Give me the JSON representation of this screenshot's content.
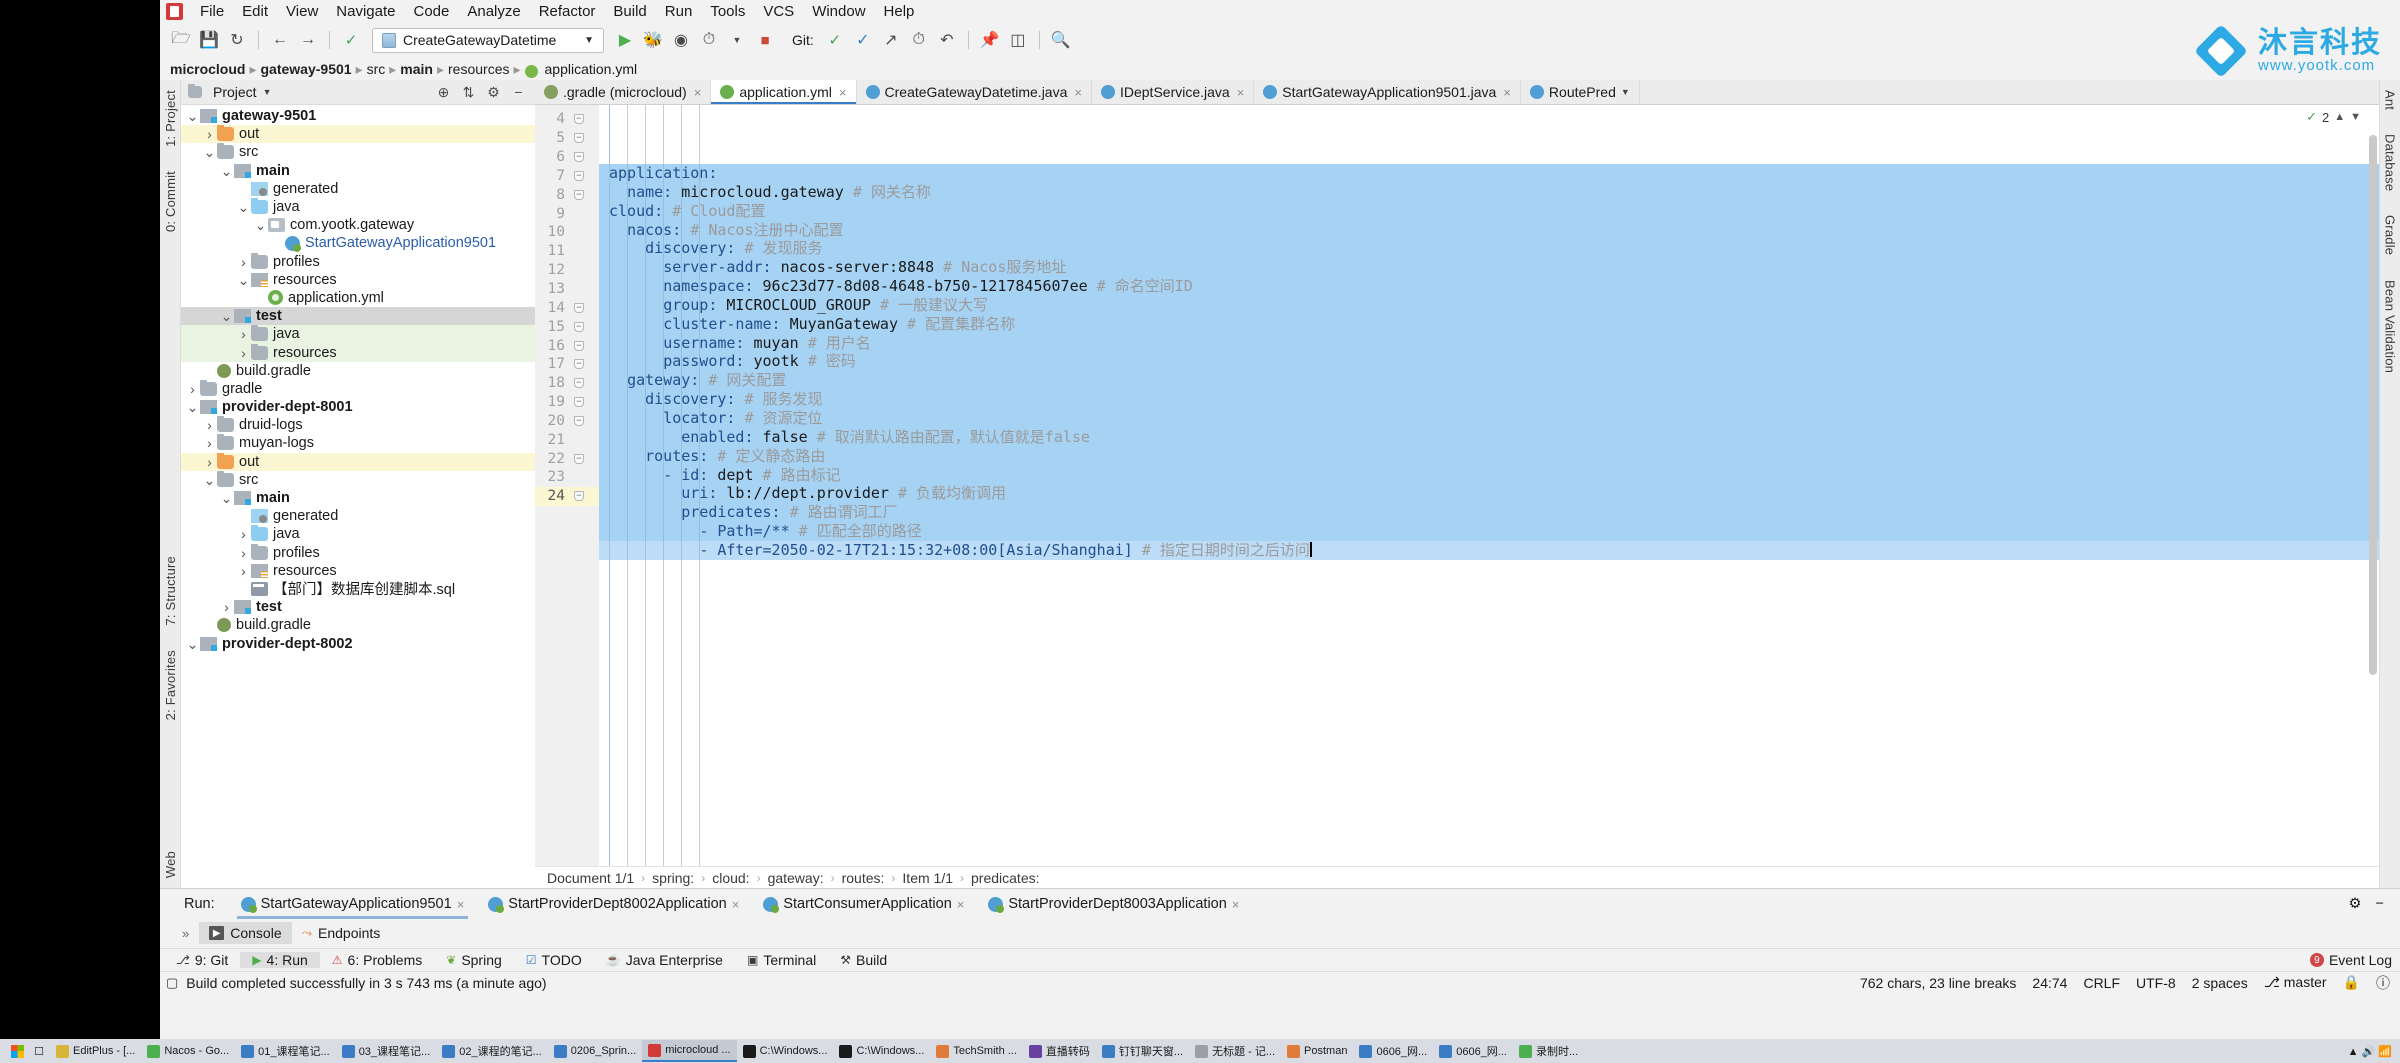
{
  "menubar": {
    "items": [
      "File",
      "Edit",
      "View",
      "Navigate",
      "Code",
      "Analyze",
      "Refactor",
      "Build",
      "Run",
      "Tools",
      "VCS",
      "Window",
      "Help"
    ]
  },
  "toolbar": {
    "run_config": "CreateGatewayDatetime",
    "git_label": "Git:",
    "watermark_cn": "沐言科技",
    "watermark_url": "www.yootk.com"
  },
  "breadcrumb": {
    "items": [
      "microcloud",
      "gateway-9501",
      "src",
      "main",
      "resources",
      "application.yml"
    ]
  },
  "project_panel": {
    "title": "Project",
    "tree": [
      {
        "label": "gateway-9501",
        "depth": 0,
        "twist": "v",
        "icon": "folder-src",
        "bold": true,
        "hl": ""
      },
      {
        "label": "out",
        "depth": 1,
        "twist": ">",
        "icon": "folder-orange",
        "bold": false,
        "hl": "hl-yellow"
      },
      {
        "label": "src",
        "depth": 1,
        "twist": "v",
        "icon": "folder",
        "bold": false,
        "hl": ""
      },
      {
        "label": "main",
        "depth": 2,
        "twist": "v",
        "icon": "folder-src",
        "bold": true,
        "hl": ""
      },
      {
        "label": "generated",
        "depth": 3,
        "twist": "",
        "icon": "folder-gen",
        "bold": false,
        "hl": ""
      },
      {
        "label": "java",
        "depth": 3,
        "twist": "v",
        "icon": "folder-blue",
        "bold": false,
        "hl": ""
      },
      {
        "label": "com.yootk.gateway",
        "depth": 4,
        "twist": "v",
        "icon": "pkg",
        "bold": false,
        "hl": ""
      },
      {
        "label": "StartGatewayApplication9501",
        "depth": 5,
        "twist": "",
        "icon": "javacls",
        "bold": false,
        "hl": "",
        "blue": true
      },
      {
        "label": "profiles",
        "depth": 3,
        "twist": ">",
        "icon": "folder",
        "bold": false,
        "hl": ""
      },
      {
        "label": "resources",
        "depth": 3,
        "twist": "v",
        "icon": "folder-res",
        "bold": false,
        "hl": ""
      },
      {
        "label": "application.yml",
        "depth": 4,
        "twist": "",
        "icon": "yml",
        "bold": false,
        "hl": ""
      },
      {
        "label": "test",
        "depth": 2,
        "twist": "v",
        "icon": "folder-src",
        "bold": true,
        "hl": "hl-gray"
      },
      {
        "label": "java",
        "depth": 3,
        "twist": ">",
        "icon": "folder",
        "bold": false,
        "hl": "hl-green"
      },
      {
        "label": "resources",
        "depth": 3,
        "twist": ">",
        "icon": "folder",
        "bold": false,
        "hl": "hl-green"
      },
      {
        "label": "build.gradle",
        "depth": 1,
        "twist": "",
        "icon": "gradlefile",
        "bold": false,
        "hl": ""
      },
      {
        "label": "gradle",
        "depth": 0,
        "twist": ">",
        "icon": "folder",
        "bold": false,
        "hl": ""
      },
      {
        "label": "provider-dept-8001",
        "depth": 0,
        "twist": "v",
        "icon": "folder-src",
        "bold": true,
        "hl": ""
      },
      {
        "label": "druid-logs",
        "depth": 1,
        "twist": ">",
        "icon": "folder",
        "bold": false,
        "hl": ""
      },
      {
        "label": "muyan-logs",
        "depth": 1,
        "twist": ">",
        "icon": "folder",
        "bold": false,
        "hl": ""
      },
      {
        "label": "out",
        "depth": 1,
        "twist": ">",
        "icon": "folder-orange",
        "bold": false,
        "hl": "hl-yellow"
      },
      {
        "label": "src",
        "depth": 1,
        "twist": "v",
        "icon": "folder",
        "bold": false,
        "hl": ""
      },
      {
        "label": "main",
        "depth": 2,
        "twist": "v",
        "icon": "folder-src",
        "bold": true,
        "hl": ""
      },
      {
        "label": "generated",
        "depth": 3,
        "twist": "",
        "icon": "folder-gen",
        "bold": false,
        "hl": ""
      },
      {
        "label": "java",
        "depth": 3,
        "twist": ">",
        "icon": "folder-blue",
        "bold": false,
        "hl": ""
      },
      {
        "label": "profiles",
        "depth": 3,
        "twist": ">",
        "icon": "folder",
        "bold": false,
        "hl": ""
      },
      {
        "label": "resources",
        "depth": 3,
        "twist": ">",
        "icon": "folder-res",
        "bold": false,
        "hl": ""
      },
      {
        "label": "【部门】数据库创建脚本.sql",
        "depth": 3,
        "twist": "",
        "icon": "sql",
        "bold": false,
        "hl": ""
      },
      {
        "label": "test",
        "depth": 2,
        "twist": ">",
        "icon": "folder-src",
        "bold": true,
        "hl": ""
      },
      {
        "label": "build.gradle",
        "depth": 1,
        "twist": "",
        "icon": "gradlefile",
        "bold": false,
        "hl": ""
      },
      {
        "label": "provider-dept-8002",
        "depth": 0,
        "twist": "v",
        "icon": "folder-src",
        "bold": true,
        "hl": ""
      }
    ]
  },
  "editor_tabs": [
    {
      "label": ".gradle (microcloud)",
      "icon": "gradle",
      "active": false,
      "close": true
    },
    {
      "label": "application.yml",
      "icon": "ymlg",
      "active": true,
      "close": true
    },
    {
      "label": "CreateGatewayDatetime.java",
      "icon": "javac",
      "active": false,
      "close": true
    },
    {
      "label": "IDeptService.java",
      "icon": "ifc",
      "active": false,
      "close": true
    },
    {
      "label": "StartGatewayApplication9501.java",
      "icon": "javac",
      "active": false,
      "close": true
    },
    {
      "label": "RoutePred",
      "icon": "javac",
      "active": false,
      "close": false
    }
  ],
  "inspection_widget": {
    "count": "2"
  },
  "code": {
    "first_line": 4,
    "lines": [
      {
        "n": 4,
        "indent": 0,
        "key": "application:",
        "value": "",
        "comment": "",
        "fold": true,
        "sel": true
      },
      {
        "n": 5,
        "indent": 2,
        "key": "name:",
        "value": "microcloud.gateway",
        "comment": "# 网关名称",
        "fold": true,
        "sel": true
      },
      {
        "n": 6,
        "indent": 0,
        "key": "cloud:",
        "value": "",
        "comment": "# Cloud配置",
        "fold": true,
        "sel": true
      },
      {
        "n": 7,
        "indent": 2,
        "key": "nacos:",
        "value": "",
        "comment": "# Nacos注册中心配置",
        "fold": true,
        "sel": true
      },
      {
        "n": 8,
        "indent": 4,
        "key": "discovery:",
        "value": "",
        "comment": "# 发现服务",
        "fold": true,
        "sel": true
      },
      {
        "n": 9,
        "indent": 6,
        "key": "server-addr:",
        "value": "nacos-server:8848",
        "comment": "# Nacos服务地址",
        "fold": false,
        "sel": true
      },
      {
        "n": 10,
        "indent": 6,
        "key": "namespace:",
        "value": "96c23d77-8d08-4648-b750-1217845607ee",
        "comment": "# 命名空间ID",
        "fold": false,
        "sel": true
      },
      {
        "n": 11,
        "indent": 6,
        "key": "group:",
        "value": "MICROCLOUD_GROUP",
        "comment": "# 一般建议大写",
        "fold": false,
        "sel": true
      },
      {
        "n": 12,
        "indent": 6,
        "key": "cluster-name:",
        "value": "MuyanGateway",
        "comment": "# 配置集群名称",
        "fold": false,
        "sel": true
      },
      {
        "n": 13,
        "indent": 6,
        "key": "username:",
        "value": "muyan",
        "comment": "# 用户名",
        "fold": false,
        "sel": true
      },
      {
        "n": 14,
        "indent": 6,
        "key": "password:",
        "value": "yootk",
        "comment": "# 密码",
        "fold": true,
        "sel": true
      },
      {
        "n": 15,
        "indent": 2,
        "key": "gateway:",
        "value": "",
        "comment": "# 网关配置",
        "fold": true,
        "sel": true
      },
      {
        "n": 16,
        "indent": 4,
        "key": "discovery:",
        "value": "",
        "comment": "# 服务发现",
        "fold": true,
        "sel": true
      },
      {
        "n": 17,
        "indent": 6,
        "key": "locator:",
        "value": "",
        "comment": "# 资源定位",
        "fold": true,
        "sel": true
      },
      {
        "n": 18,
        "indent": 8,
        "key": "enabled:",
        "value": "false",
        "comment": "# 取消默认路由配置，默认值就是false",
        "fold": true,
        "sel": true
      },
      {
        "n": 19,
        "indent": 4,
        "key": "routes:",
        "value": "",
        "comment": "# 定义静态路由",
        "fold": true,
        "sel": true
      },
      {
        "n": 20,
        "indent": 6,
        "key": "- id:",
        "value": "dept",
        "comment": "# 路由标记",
        "fold": true,
        "sel": true
      },
      {
        "n": 21,
        "indent": 8,
        "key": "uri:",
        "value": "lb://dept.provider",
        "comment": "# 负载均衡调用",
        "fold": false,
        "sel": true
      },
      {
        "n": 22,
        "indent": 8,
        "key": "predicates:",
        "value": "",
        "comment": "# 路由谓词工厂",
        "fold": true,
        "sel": true
      },
      {
        "n": 23,
        "indent": 10,
        "key": "- Path=/**",
        "value": "",
        "comment": "# 匹配全部的路径",
        "fold": false,
        "sel": true
      },
      {
        "n": 24,
        "indent": 10,
        "key": "- After=2050-02-17T21:15:32+08:00[Asia/Shanghai]",
        "value": "",
        "comment": "# 指定日期时间之后访问",
        "fold": true,
        "sel": true,
        "cursor": true
      }
    ]
  },
  "editor_footer_crumbs": [
    "Document 1/1",
    "spring:",
    "cloud:",
    "gateway:",
    "routes:",
    "Item 1/1",
    "predicates:"
  ],
  "run_window": {
    "label": "Run:",
    "tabs": [
      {
        "label": "StartGatewayApplication9501",
        "active": true
      },
      {
        "label": "StartProviderDept8002Application",
        "active": false
      },
      {
        "label": "StartConsumerApplication",
        "active": false
      },
      {
        "label": "StartProviderDept8003Application",
        "active": false
      }
    ],
    "subtabs": [
      {
        "label": "Console",
        "icon": "console",
        "active": true
      },
      {
        "label": "Endpoints",
        "icon": "endpoints",
        "active": false
      }
    ]
  },
  "bottom_toolstrip": {
    "items": [
      {
        "label": "9: Git",
        "icon": "git"
      },
      {
        "label": "4: Run",
        "icon": "run",
        "active": true
      },
      {
        "label": "6: Problems",
        "icon": "problems"
      },
      {
        "label": "Spring",
        "icon": "spring"
      },
      {
        "label": "TODO",
        "icon": "todo"
      },
      {
        "label": "Java Enterprise",
        "icon": "javaee"
      },
      {
        "label": "Terminal",
        "icon": "terminal"
      },
      {
        "label": "Build",
        "icon": "build"
      }
    ],
    "event_log": "Event Log",
    "event_log_count": "9"
  },
  "statusbar": {
    "message": "Build completed successfully in 3 s 743 ms (a minute ago)",
    "right": [
      "762 chars, 23 line breaks",
      "24:74",
      "CRLF",
      "UTF-8",
      "2 spaces",
      "master"
    ]
  },
  "left_strips": [
    {
      "label": "1: Project"
    },
    {
      "label": "0: Commit"
    },
    {
      "label": "7: Structure"
    },
    {
      "label": "2: Favorites"
    },
    {
      "label": "Web"
    }
  ],
  "right_strips": [
    {
      "label": "Ant"
    },
    {
      "label": "Database"
    },
    {
      "label": "Gradle"
    },
    {
      "label": "Bean Validation"
    }
  ],
  "taskbar": {
    "apps": [
      {
        "label": "EditPlus - [...",
        "color": "#d8b43a"
      },
      {
        "label": "Nacos - Go...",
        "color": "#4caf50"
      },
      {
        "label": "01_课程笔记...",
        "color": "#3b7dc4"
      },
      {
        "label": "03_课程笔记...",
        "color": "#3b7dc4"
      },
      {
        "label": "02_课程的笔记...",
        "color": "#3b7dc4"
      },
      {
        "label": "0206_Sprin...",
        "color": "#3b7dc4"
      },
      {
        "label": "microcloud ...",
        "color": "#d23a3a",
        "selected": true
      },
      {
        "label": "C:\\Windows...",
        "color": "#1a1a1a"
      },
      {
        "label": "C:\\Windows...",
        "color": "#1a1a1a"
      },
      {
        "label": "TechSmith ...",
        "color": "#e07b39"
      },
      {
        "label": "直播转码",
        "color": "#6a3fa0"
      },
      {
        "label": "钉钉聊天窗...",
        "color": "#3b7dc4"
      },
      {
        "label": "无标题 - 记...",
        "color": "#9aa0a6"
      },
      {
        "label": "Postman",
        "color": "#e07b39"
      },
      {
        "label": "0606_网...",
        "color": "#3b7dc4"
      },
      {
        "label": "0606_网...",
        "color": "#3b7dc4"
      },
      {
        "label": "录制时...",
        "color": "#4caf50"
      }
    ]
  }
}
